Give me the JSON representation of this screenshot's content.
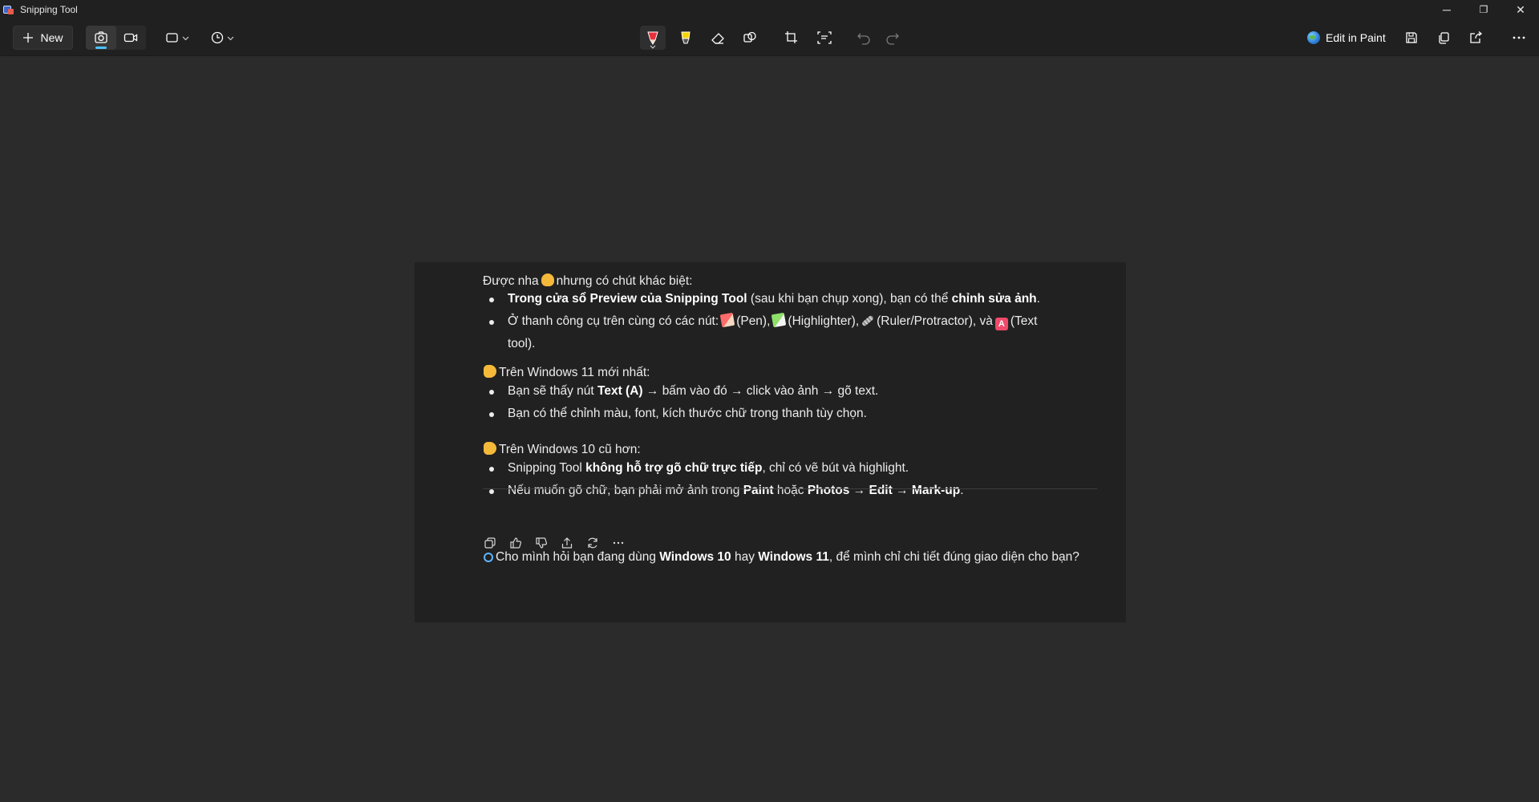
{
  "window": {
    "title": "Snipping Tool",
    "controls": {
      "minimize": "─",
      "restore": "❐",
      "close": "✕"
    }
  },
  "toolbar": {
    "new_label": "New",
    "edit_in_paint_label": "Edit in Paint",
    "icons": [
      "plus-icon",
      "camera-icon",
      "video-icon",
      "rectangle-mode-icon",
      "timer-icon",
      "ballpoint-pen-icon",
      "highlighter-icon",
      "eraser-icon",
      "shapes-icon",
      "crop-icon",
      "text-actions-icon",
      "undo-icon",
      "redo-icon",
      "paint-globe-icon",
      "save-icon",
      "copy-icon",
      "share-icon",
      "more-icon"
    ],
    "accent": "#4cc2ff",
    "pen_color": "#e8303c",
    "highlighter_color": "#f5d300"
  },
  "screenshot": {
    "intro": {
      "a": "Được nha",
      "b": "nhưng có chút khác biệt:"
    },
    "b1": {
      "bold1": "Trong cửa sổ Preview của Snipping Tool",
      "t1": " (sau khi bạn chụp xong), bạn có thể ",
      "bold2": "chỉnh sửa ảnh",
      "t2": "."
    },
    "b2": {
      "a": "Ở thanh công cụ trên cùng có các nút:",
      "b": "(Pen),",
      "c": "(Highlighter),",
      "d": "(Ruler/Protractor), và",
      "e": "(Text",
      "f": "tool).",
      "a_glyph": "A"
    },
    "h1": "Trên Windows 11 mới nhất:",
    "b3": {
      "t1": "Bạn sẽ thấy nút ",
      "bold1": "Text (A)",
      "t2": " → bấm vào đó → click vào ảnh → gõ text."
    },
    "b4": "Bạn có thể chỉnh màu, font, kích thước chữ trong thanh tùy chọn.",
    "h2": "Trên Windows 10 cũ hơn:",
    "b5": {
      "t1": "Snipping Tool ",
      "bold1": "không hỗ trợ gõ chữ trực tiếp",
      "t2": ", chỉ có vẽ bút và highlight."
    },
    "b6": {
      "t1": "Nếu muốn gõ chữ, bạn phải mở ảnh trong ",
      "bold1": "Paint",
      "t2": " hoặc ",
      "bold2": "Photos",
      "t3": " → ",
      "bold3": "Edit",
      "t4": " → ",
      "bold4": "Mark-up",
      "t5": "."
    },
    "q": {
      "t1": "Cho mình hỏi bạn đang dùng ",
      "bold1": "Windows 10",
      "t2": " hay ",
      "bold2": "Windows 11",
      "t3": ", để mình chỉ chi tiết đúng giao diện cho bạn?"
    },
    "actions": [
      "copy-icon",
      "thumbs-up-icon",
      "thumbs-down-icon",
      "share-icon",
      "regenerate-icon",
      "more-icon"
    ]
  }
}
